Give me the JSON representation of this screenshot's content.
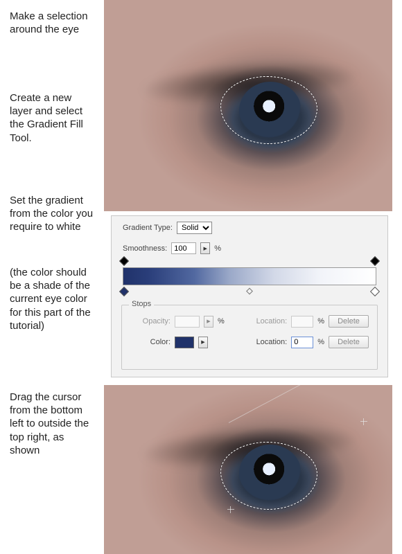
{
  "instructions": {
    "step1": "Make a selection around the eye",
    "step2": "Create a new layer and select the Gradient Fill Tool.",
    "step3": "Set the gradient from the color you require to white",
    "step3_note": "(the color should be a shade of the current eye color for this part of the tutorial)",
    "step4": "Drag the cursor from the bottom left to outside the top right, as shown"
  },
  "panel": {
    "gradient_type_label": "Gradient Type:",
    "gradient_type_value": "Solid",
    "smoothness_label": "Smoothness:",
    "smoothness_value": "100",
    "percent": "%",
    "gradient_start_color": "#20326a",
    "gradient_end_color": "#ffffff",
    "stops_legend": "Stops",
    "opacity_label": "Opacity:",
    "color_label": "Color:",
    "location_label": "Location:",
    "location_value": "0",
    "delete_label": "Delete",
    "step_glyph": "▶"
  }
}
